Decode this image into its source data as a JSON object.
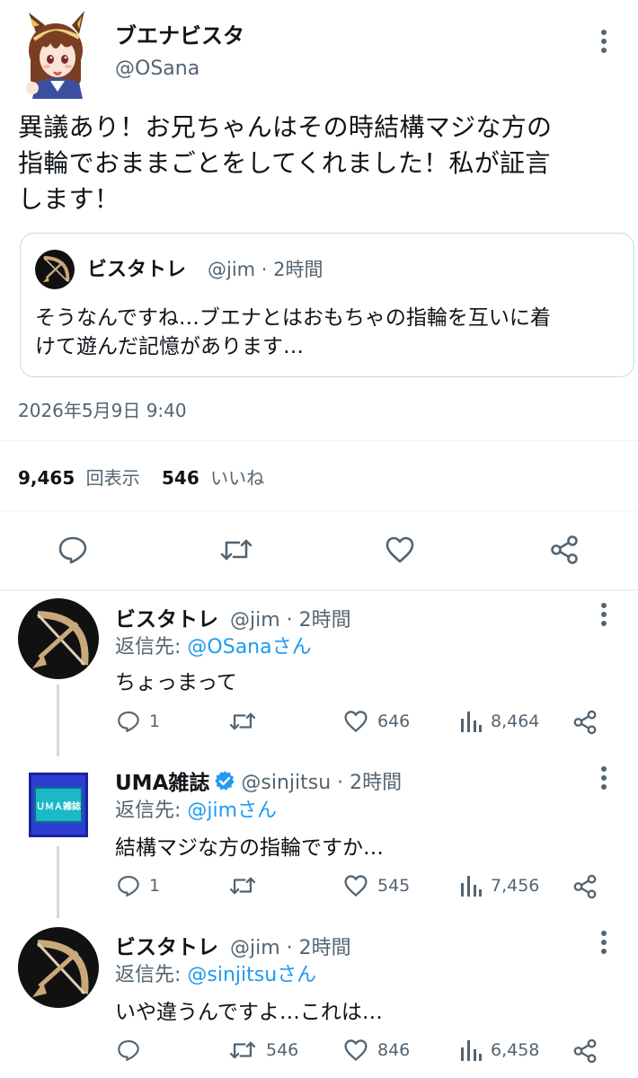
{
  "main_tweet": {
    "display_name": "ブエナビスタ",
    "handle": "@OSana",
    "text_lines": [
      "異議あり！お兄ちゃんはその時結構マジな方の",
      "指輪でおままごとをしてくれました！私が証言",
      "します！"
    ],
    "timestamp": "2026年5月9日 9:40",
    "views_count": "9,465",
    "views_label": "回表示",
    "likes_count": "546",
    "likes_label": "いいね"
  },
  "quoted_tweet": {
    "display_name": "ビスタトレ",
    "handle_time": "@jim · 2時間",
    "text_lines": [
      "そうなんですね…ブエナとはおもちゃの指輪を互いに着",
      "けて遊んだ記憶があります…"
    ]
  },
  "replies": [
    {
      "display_name": "ビスタトレ",
      "handle_time": "@jim · 2時間",
      "reply_prefix": "返信先: ",
      "reply_target": "@OSanaさん",
      "text": "ちょっまって",
      "reply_count": "1",
      "retweet_count": "",
      "like_count": "646",
      "view_count": "8,464"
    },
    {
      "display_name": "UMA雑誌",
      "handle_time": "@sinjitsu · 2時間",
      "reply_prefix": "返信先: ",
      "reply_target": "@jimさん",
      "text": "結構マジな方の指輪ですか…",
      "reply_count": "1",
      "retweet_count": "",
      "like_count": "545",
      "view_count": "7,456",
      "avatar_text": "ＵＭＡ雑誌"
    },
    {
      "display_name": "ビスタトレ",
      "handle_time": "@jim · 2時間",
      "reply_prefix": "返信先: ",
      "reply_target": "@sinjitsuさん",
      "text": "いや違うんですよ…これは…",
      "reply_count": "",
      "retweet_count": "546",
      "like_count": "846",
      "view_count": "6,458"
    }
  ],
  "icons": {
    "more": "more-vertical-icon",
    "reply": "reply-bubble-icon",
    "retweet": "retweet-icon",
    "like": "heart-icon",
    "views": "views-bars-icon",
    "share": "share-icon",
    "verified": "verified-badge-icon"
  },
  "colors": {
    "text": "#0f1419",
    "secondary": "#536471",
    "link": "#1d9bf0",
    "divider": "#eff3f4",
    "verified": "#1d9bf0"
  }
}
